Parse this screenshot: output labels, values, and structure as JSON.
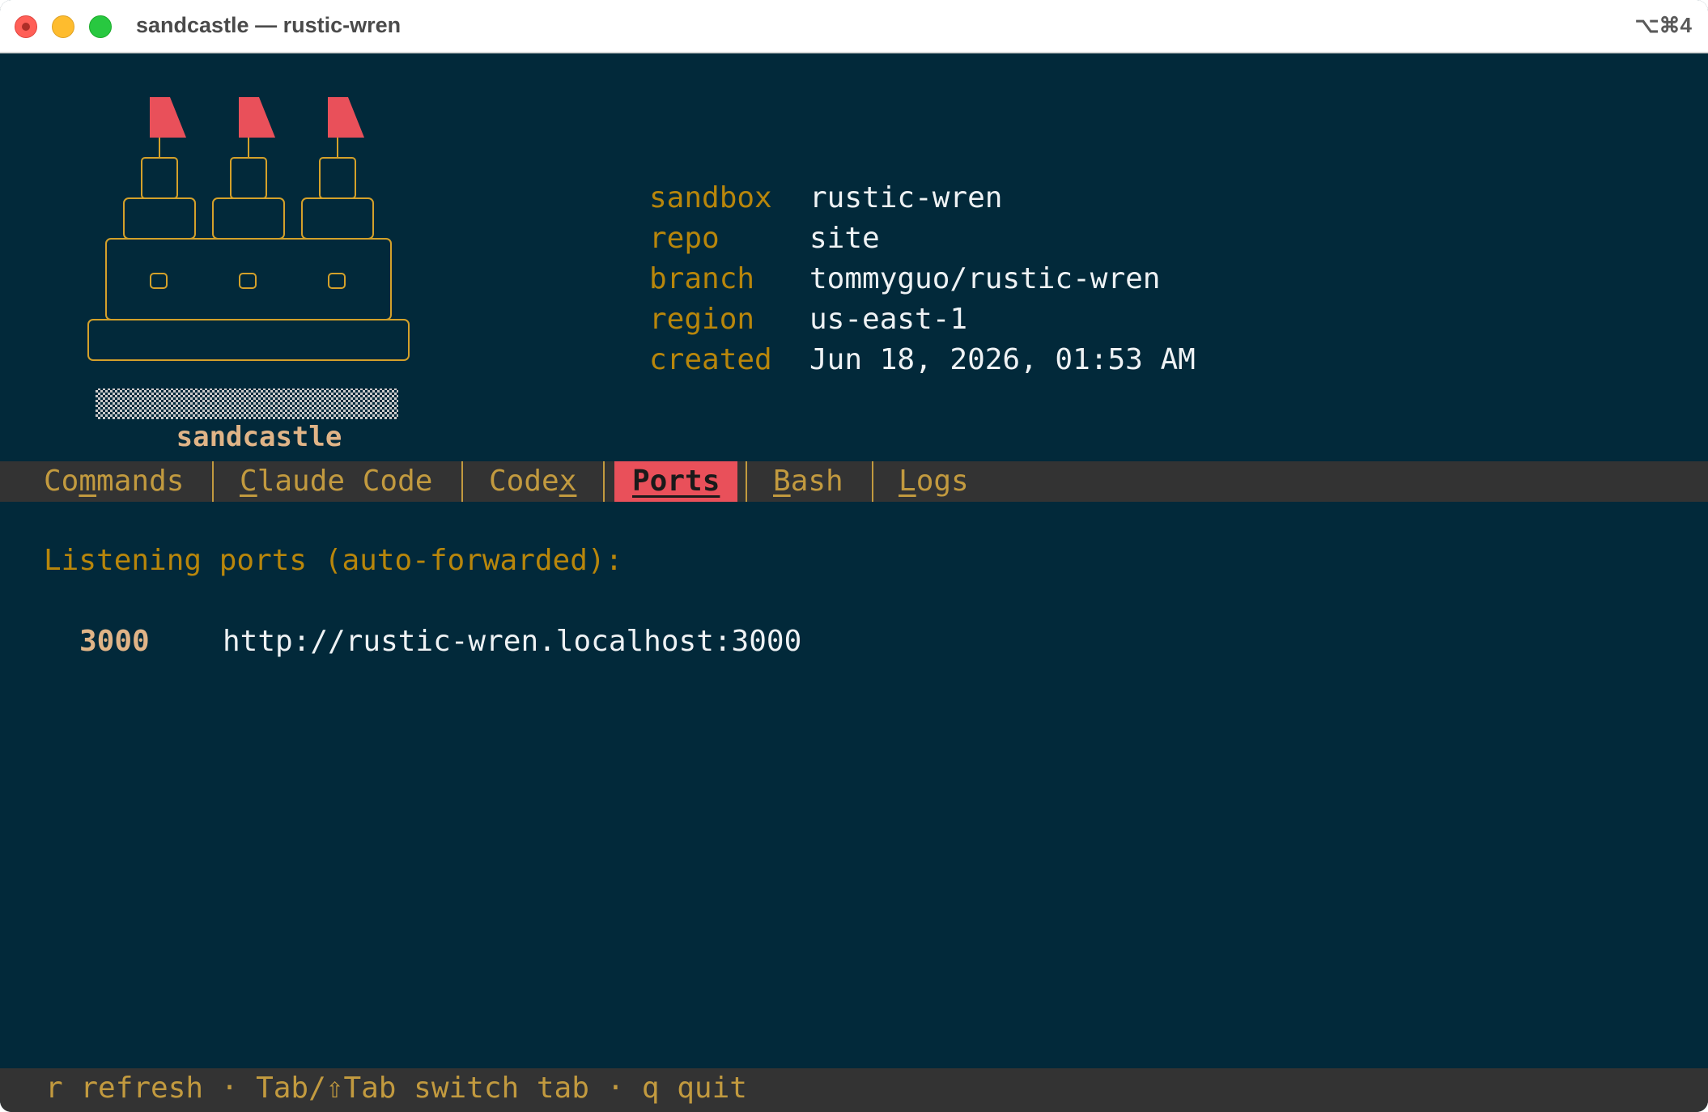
{
  "window": {
    "title": "sandcastle — rustic-wren",
    "shortcut": "⌥⌘4"
  },
  "brand": {
    "name": "sandcastle"
  },
  "info": [
    {
      "key": "sandbox",
      "value": "rustic-wren"
    },
    {
      "key": "repo",
      "value": "site"
    },
    {
      "key": "branch",
      "value": "tommyguo/rustic-wren"
    },
    {
      "key": "region",
      "value": "us-east-1"
    },
    {
      "key": "created",
      "value": "Jun 18, 2026, 01:53 AM"
    }
  ],
  "tabs": [
    {
      "pre": "Co",
      "u": "m",
      "post": "mands",
      "active": false
    },
    {
      "pre": "",
      "u": "C",
      "post": "laude Code",
      "active": false
    },
    {
      "pre": "Code",
      "u": "x",
      "post": "",
      "active": false
    },
    {
      "pre": "",
      "u": "",
      "post": "Ports",
      "active": true
    },
    {
      "pre": "",
      "u": "B",
      "post": "ash",
      "active": false
    },
    {
      "pre": "",
      "u": "L",
      "post": "ogs",
      "active": false
    }
  ],
  "ports": {
    "heading": "Listening ports (auto-forwarded):",
    "items": [
      {
        "port": "3000",
        "url": "http://rustic-wren.localhost:3000"
      }
    ]
  },
  "status": {
    "text": "r refresh · Tab/⇧Tab switch tab · q quit"
  },
  "colors": {
    "background": "#02293a",
    "accent": "#e9505a",
    "key": "#b8860b",
    "tab_text": "#c29a3f",
    "bar": "#333333"
  }
}
